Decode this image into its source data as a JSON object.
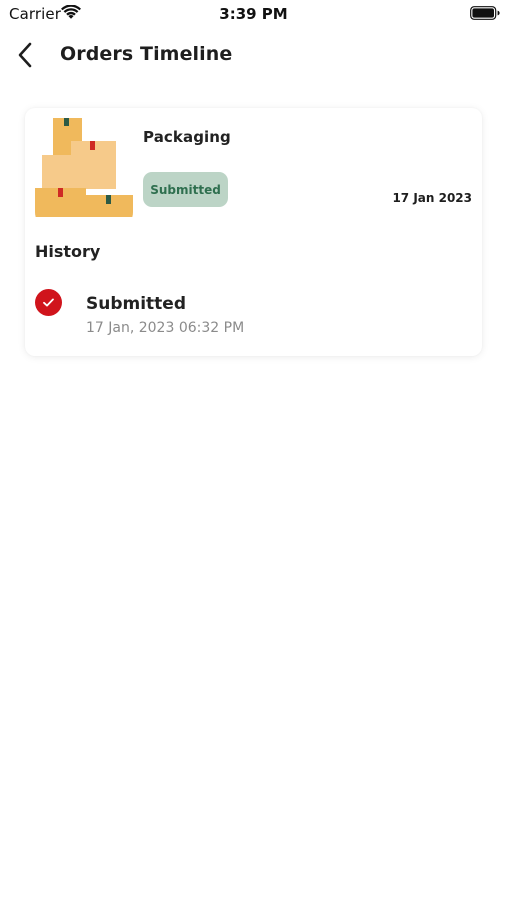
{
  "status_bar": {
    "carrier": "Carrier",
    "time": "3:39 PM",
    "wifi_icon": "wifi-icon",
    "battery_icon": "battery-icon"
  },
  "header": {
    "back_icon": "chevron-left-icon",
    "title": "Orders Timeline"
  },
  "order": {
    "image_icon": "packages-icon",
    "name": "Packaging",
    "status": "Submitted",
    "date": "17 Jan 2023"
  },
  "history": {
    "heading": "History",
    "items": [
      {
        "icon": "check-circle-icon",
        "status": "Submitted",
        "timestamp": "17 Jan, 2023 06:32 PM"
      }
    ]
  },
  "colors": {
    "badge_background": "#bcd4c6",
    "badge_text": "#2f6f4f",
    "check_red": "#d0141c",
    "box_main": "#f0b95c",
    "box_light": "#f6ca8a",
    "tape_green": "#2c5a45",
    "tape_red": "#cf2a24"
  }
}
